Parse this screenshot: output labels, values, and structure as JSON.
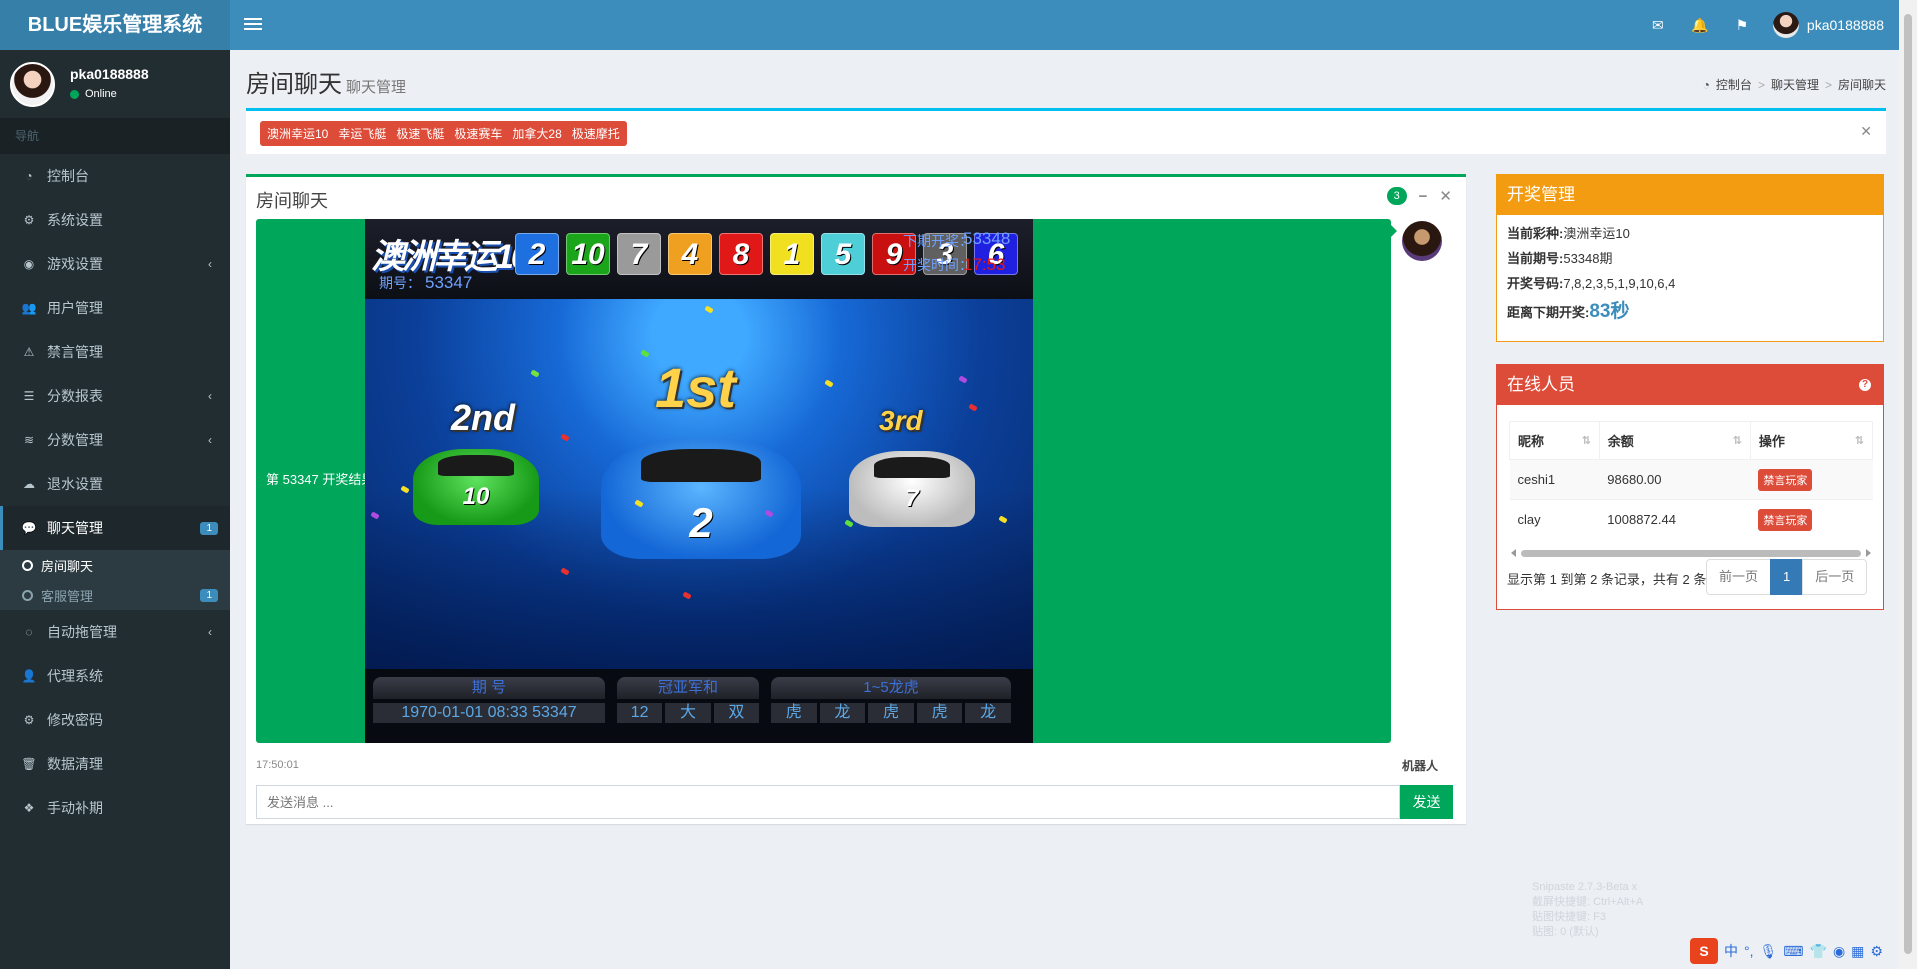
{
  "app": {
    "title": "BLUE娱乐管理系统"
  },
  "topbar": {
    "username": "pka0188888",
    "icons": [
      "mail-icon",
      "bell-icon",
      "flag-icon"
    ]
  },
  "sidebar": {
    "user": {
      "name": "pka0188888",
      "status": "Online"
    },
    "nav_header": "导航",
    "items": [
      {
        "label": "控制台",
        "icon": "dashboard-icon"
      },
      {
        "label": "系统设置",
        "icon": "gears-icon"
      },
      {
        "label": "游戏设置",
        "icon": "gamepad-icon"
      },
      {
        "label": "用户管理",
        "icon": "users-icon"
      },
      {
        "label": "禁言管理",
        "icon": "warning-icon"
      },
      {
        "label": "分数报表",
        "icon": "list-icon"
      },
      {
        "label": "分数管理",
        "icon": "database-icon"
      },
      {
        "label": "退水设置",
        "icon": "cloud-download-icon"
      },
      {
        "label": "聊天管理",
        "icon": "comments-icon",
        "badge": "1"
      },
      {
        "label": "自动拖管理",
        "icon": "comment-icon"
      },
      {
        "label": "代理系统",
        "icon": "user-plus-icon"
      },
      {
        "label": "修改密码",
        "icon": "gear-icon"
      },
      {
        "label": "数据清理",
        "icon": "trash-icon"
      },
      {
        "label": "手动补期",
        "icon": "cubes-icon"
      }
    ],
    "submenu": [
      {
        "label": "房间聊天"
      },
      {
        "label": "客服管理",
        "badge": "1"
      }
    ]
  },
  "header": {
    "title": "房间聊天",
    "subtitle": "聊天管理",
    "breadcrumb": [
      "控制台",
      "聊天管理",
      "房间聊天"
    ]
  },
  "lottery_tags": [
    "澳洲幸运10",
    "幸运飞艇",
    "极速飞艇",
    "极速赛车",
    "加拿大28",
    "极速摩托"
  ],
  "chat": {
    "title": "房间聊天",
    "count": "3",
    "message_text": "第 53347 开奖结果!",
    "time": "17:50:01",
    "sender": "机器人",
    "input_placeholder": "发送消息 ...",
    "send_label": "发送",
    "image": {
      "logo": "澳洲幸运10",
      "issue_label": "期号：",
      "issue": "53347",
      "balls": [
        {
          "n": "2",
          "color": "#1e6fe0"
        },
        {
          "n": "10",
          "color": "#1aa51a"
        },
        {
          "n": "7",
          "color": "#9a9a9a"
        },
        {
          "n": "4",
          "color": "#f0a020"
        },
        {
          "n": "8",
          "color": "#e01818"
        },
        {
          "n": "1",
          "color": "#f0e020"
        },
        {
          "n": "5",
          "color": "#4ecfd8"
        },
        {
          "n": "9",
          "color": "#c81010"
        },
        {
          "n": "3",
          "color": "#606060"
        },
        {
          "n": "6",
          "color": "#2020e0"
        }
      ],
      "next_label": "下期开奖：",
      "next_issue": "53348",
      "time_label": "开奖时间：",
      "time": "17:53",
      "places": {
        "first": "1st",
        "second": "2nd",
        "third": "3rd"
      },
      "cars": {
        "first": "2",
        "second": "10",
        "third": "7"
      },
      "panel_issue": {
        "title": "期  号",
        "value": "1970-01-01 08:33 53347"
      },
      "panel_sum": {
        "title": "冠亚军和",
        "cells": [
          "12",
          "大",
          "双"
        ]
      },
      "panel_dragon": {
        "title": "1~5龙虎",
        "cells": [
          "虎",
          "龙",
          "虎",
          "虎",
          "龙"
        ]
      }
    }
  },
  "draw": {
    "title": "开奖管理",
    "lines": [
      {
        "label": "当前彩种:",
        "value": "澳洲幸运10"
      },
      {
        "label": "当前期号:",
        "value": "53348期"
      },
      {
        "label": "开奖号码:",
        "value": "7,8,2,3,5,1,9,10,6,4"
      }
    ],
    "countdown_label": "距离下期开奖:",
    "countdown": "83秒"
  },
  "online": {
    "title": "在线人员",
    "columns": [
      "昵称",
      "余额",
      "操作"
    ],
    "rows": [
      {
        "name": "ceshi1",
        "balance": "98680.00",
        "action": "禁言玩家"
      },
      {
        "name": "clay",
        "balance": "1008872.44",
        "action": "禁言玩家"
      }
    ],
    "page_info": "显示第 1 到第 2 条记录，共有 2 条",
    "prev_label": "前一页",
    "page": "1",
    "next_label": "后一页"
  },
  "ime": {
    "tip_lines": [
      "Snipaste 2.7.3-Beta x",
      "截屏快捷键: Ctrl+Alt+A",
      "贴图快捷键: F3",
      "贴图: 0 (默认)"
    ],
    "lang": "中"
  }
}
